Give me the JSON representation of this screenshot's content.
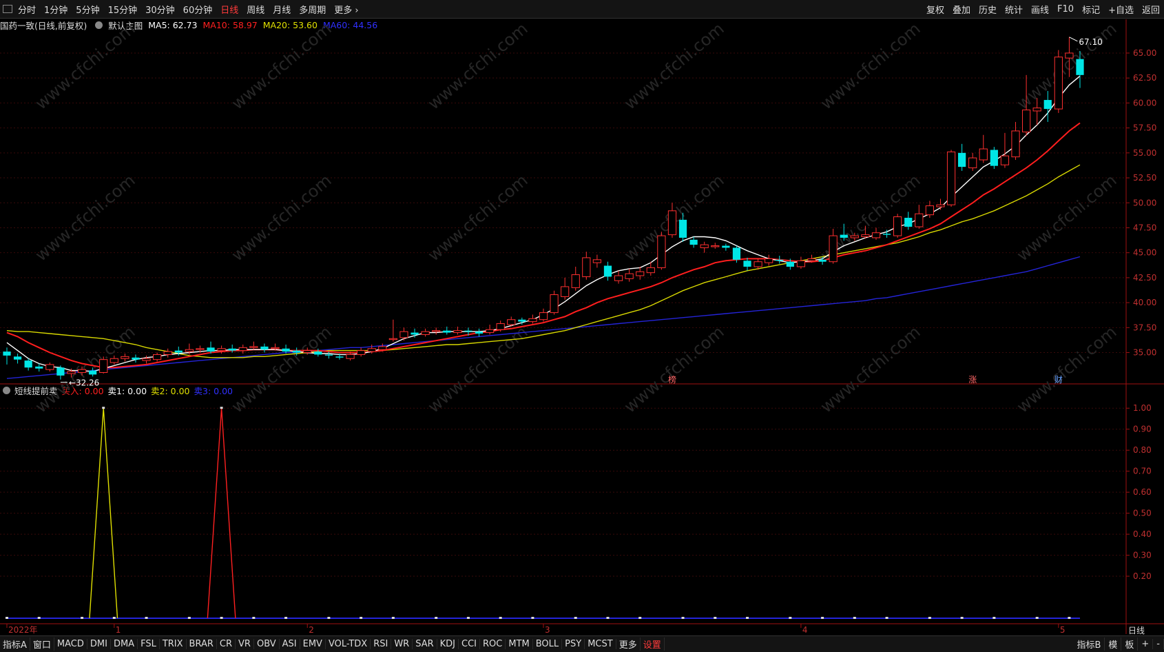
{
  "topbar": {
    "periods": [
      "分时",
      "1分钟",
      "5分钟",
      "15分钟",
      "30分钟",
      "60分钟",
      "日线",
      "周线",
      "月线",
      "多周期",
      "更多 ›"
    ],
    "active_period": "日线",
    "tools": [
      "复权",
      "叠加",
      "历史",
      "统计",
      "画线",
      "F10",
      "标记",
      "+自选",
      "返回"
    ]
  },
  "main_legend": {
    "stock": "国药一致(日线,前复权)",
    "template": "默认主图",
    "ma": [
      {
        "label": "MA5: 62.73",
        "color": "#ffffff"
      },
      {
        "label": "MA10: 58.97",
        "color": "#ff2020"
      },
      {
        "label": "MA20: 53.60",
        "color": "#e0e000"
      },
      {
        "label": "MA60: 44.56",
        "color": "#3030ff"
      }
    ]
  },
  "sub_legend": {
    "name": "短线提前卖",
    "items": [
      {
        "label": "买入: 0.00",
        "color": "#ff2020"
      },
      {
        "label": "卖1: 0.00",
        "color": "#ffffff"
      },
      {
        "label": "卖2: 0.00",
        "color": "#e0e000"
      },
      {
        "label": "卖3: 0.00",
        "color": "#3030ff"
      }
    ]
  },
  "chart_data": [
    {
      "type": "candlestick",
      "title": "国药一致(日线,前复权)",
      "ylim": [
        32,
        67
      ],
      "y_ticks": [
        "65.00",
        "62.50",
        "60.00",
        "57.50",
        "55.00",
        "52.50",
        "50.00",
        "47.50",
        "45.00",
        "42.50",
        "40.00",
        "37.50",
        "35.00"
      ],
      "x_labels": [
        "2022年",
        "1",
        "2",
        "3",
        "4",
        "5"
      ],
      "annotations": {
        "high": "67.10",
        "low": "32.26",
        "markers": [
          "榜",
          "涨",
          "财"
        ]
      },
      "candles": [
        [
          35.1,
          34.7,
          35.5,
          33.8
        ],
        [
          34.6,
          34.3,
          34.9,
          33.9
        ],
        [
          34.2,
          33.5,
          34.4,
          33.2
        ],
        [
          33.6,
          33.4,
          33.9,
          33.1
        ],
        [
          33.3,
          33.8,
          34.0,
          33.1
        ],
        [
          33.5,
          32.7,
          33.7,
          32.3
        ],
        [
          32.9,
          33.1,
          33.4,
          32.5
        ],
        [
          33.0,
          33.3,
          33.6,
          32.7
        ],
        [
          33.2,
          32.8,
          33.5,
          32.6
        ],
        [
          33.0,
          34.3,
          34.6,
          32.9
        ],
        [
          34.0,
          34.4,
          34.7,
          33.8
        ],
        [
          34.4,
          34.6,
          34.9,
          34.1
        ],
        [
          34.5,
          34.3,
          34.8,
          34.0
        ],
        [
          34.2,
          34.4,
          34.7,
          33.9
        ],
        [
          34.3,
          34.8,
          35.0,
          34.1
        ],
        [
          34.8,
          35.1,
          35.4,
          34.5
        ],
        [
          35.2,
          35.0,
          35.6,
          34.7
        ],
        [
          35.1,
          35.3,
          35.9,
          34.8
        ],
        [
          35.3,
          35.4,
          35.7,
          35.0
        ],
        [
          35.5,
          35.1,
          36.1,
          34.9
        ],
        [
          35.2,
          35.4,
          35.7,
          34.9
        ],
        [
          35.4,
          35.2,
          35.8,
          35.0
        ],
        [
          35.2,
          35.5,
          35.8,
          34.9
        ],
        [
          35.5,
          35.6,
          36.1,
          35.3
        ],
        [
          35.6,
          35.3,
          35.9,
          35.0
        ],
        [
          35.4,
          35.5,
          35.9,
          35.2
        ],
        [
          35.4,
          35.1,
          35.8,
          34.9
        ],
        [
          35.2,
          35.0,
          35.5,
          34.7
        ],
        [
          35.0,
          35.2,
          35.5,
          34.8
        ],
        [
          35.1,
          34.8,
          35.4,
          34.6
        ],
        [
          34.8,
          34.7,
          35.1,
          34.4
        ],
        [
          34.6,
          34.5,
          34.9,
          34.3
        ],
        [
          34.4,
          34.8,
          35.1,
          34.2
        ],
        [
          34.8,
          35.2,
          35.5,
          34.6
        ],
        [
          35.1,
          35.4,
          35.8,
          34.9
        ],
        [
          35.3,
          35.6,
          35.9,
          35.1
        ],
        [
          36.3,
          36.4,
          38.3,
          36.1
        ],
        [
          36.5,
          37.1,
          37.5,
          36.2
        ],
        [
          37.0,
          36.8,
          37.4,
          36.5
        ],
        [
          36.8,
          37.1,
          37.4,
          36.6
        ],
        [
          37.1,
          37.2,
          37.5,
          36.8
        ],
        [
          37.2,
          37.0,
          37.6,
          36.8
        ],
        [
          37.0,
          37.2,
          37.6,
          36.8
        ],
        [
          37.2,
          37.1,
          37.5,
          36.7
        ],
        [
          37.1,
          36.9,
          37.4,
          36.6
        ],
        [
          37.0,
          37.3,
          37.8,
          36.8
        ],
        [
          37.3,
          37.9,
          38.2,
          37.1
        ],
        [
          37.8,
          38.3,
          38.6,
          37.6
        ],
        [
          38.3,
          38.1,
          38.5,
          37.8
        ],
        [
          38.1,
          38.4,
          38.8,
          37.9
        ],
        [
          38.3,
          39.0,
          39.4,
          38.1
        ],
        [
          39.0,
          40.8,
          41.2,
          38.8
        ],
        [
          40.6,
          41.6,
          42.5,
          40.3
        ],
        [
          41.5,
          42.8,
          43.6,
          41.2
        ],
        [
          42.6,
          44.5,
          45.1,
          42.3
        ],
        [
          44.0,
          44.3,
          44.8,
          43.5
        ],
        [
          43.7,
          42.6,
          44.1,
          42.2
        ],
        [
          42.2,
          42.7,
          43.2,
          41.9
        ],
        [
          42.4,
          42.9,
          43.4,
          42.1
        ],
        [
          42.7,
          43.1,
          43.6,
          42.3
        ],
        [
          43.0,
          43.5,
          44.1,
          42.7
        ],
        [
          43.5,
          46.7,
          47.1,
          43.3
        ],
        [
          46.8,
          49.2,
          50.0,
          46.5
        ],
        [
          48.3,
          46.5,
          49.0,
          46.1
        ],
        [
          46.3,
          45.8,
          46.6,
          45.5
        ],
        [
          45.5,
          45.8,
          46.1,
          45.0
        ],
        [
          45.6,
          45.7,
          46.0,
          45.4
        ],
        [
          45.7,
          45.5,
          45.9,
          45.2
        ],
        [
          45.5,
          44.3,
          45.7,
          44.0
        ],
        [
          44.2,
          43.6,
          44.5,
          43.2
        ],
        [
          43.6,
          44.1,
          44.4,
          43.3
        ],
        [
          44.0,
          44.4,
          44.8,
          43.7
        ],
        [
          44.3,
          44.2,
          44.7,
          43.9
        ],
        [
          44.1,
          43.6,
          44.4,
          43.3
        ],
        [
          43.6,
          44.2,
          44.6,
          43.4
        ],
        [
          44.2,
          44.4,
          44.8,
          44.0
        ],
        [
          44.3,
          44.1,
          44.6,
          43.8
        ],
        [
          44.1,
          46.7,
          47.4,
          43.9
        ],
        [
          46.8,
          46.5,
          47.9,
          46.2
        ],
        [
          46.5,
          46.7,
          47.0,
          46.2
        ],
        [
          46.6,
          46.8,
          47.7,
          46.4
        ],
        [
          46.5,
          47.0,
          47.5,
          46.3
        ],
        [
          46.9,
          46.8,
          47.3,
          46.5
        ],
        [
          46.7,
          48.6,
          48.9,
          46.5
        ],
        [
          48.5,
          47.6,
          49.1,
          47.3
        ],
        [
          47.6,
          48.9,
          49.8,
          47.4
        ],
        [
          48.8,
          49.7,
          50.2,
          48.5
        ],
        [
          49.6,
          49.8,
          50.4,
          49.3
        ],
        [
          49.8,
          55.1,
          55.3,
          49.6
        ],
        [
          55.0,
          53.6,
          55.9,
          53.2
        ],
        [
          53.5,
          54.5,
          55.0,
          53.2
        ],
        [
          54.3,
          55.4,
          56.8,
          54.0
        ],
        [
          55.3,
          53.7,
          55.6,
          53.4
        ],
        [
          53.8,
          54.7,
          57.0,
          53.5
        ],
        [
          54.6,
          57.2,
          58.1,
          54.3
        ],
        [
          57.1,
          59.3,
          62.8,
          56.7
        ],
        [
          59.2,
          59.5,
          60.5,
          57.8
        ],
        [
          60.3,
          59.4,
          61.2,
          58.1
        ],
        [
          59.4,
          64.6,
          65.3,
          59.0
        ],
        [
          64.5,
          65.0,
          66.6,
          62.6
        ],
        [
          64.4,
          62.8,
          65.2,
          61.5
        ]
      ],
      "ma5": [
        36.0,
        35.2,
        34.4,
        33.9,
        33.6,
        33.5,
        33.2,
        33.2,
        33.1,
        33.4,
        33.7,
        34.0,
        34.3,
        34.5,
        34.6,
        34.8,
        34.9,
        35.0,
        35.1,
        35.2,
        35.2,
        35.3,
        35.3,
        35.3,
        35.3,
        35.3,
        35.2,
        35.1,
        35.0,
        34.9,
        34.9,
        34.8,
        34.8,
        34.9,
        35.1,
        35.4,
        35.9,
        36.4,
        36.7,
        37.0,
        37.0,
        37.1,
        37.1,
        37.1,
        37.1,
        37.2,
        37.4,
        37.7,
        38.0,
        38.3,
        38.8,
        39.4,
        40.1,
        40.9,
        41.7,
        42.3,
        42.8,
        43.2,
        43.4,
        43.5,
        44.0,
        44.8,
        45.6,
        46.2,
        46.6,
        46.6,
        46.5,
        46.2,
        45.7,
        45.2,
        44.8,
        44.4,
        44.2,
        44.0,
        44.1,
        44.2,
        44.4,
        45.1,
        45.7,
        46.1,
        46.5,
        46.8,
        47.1,
        47.6,
        47.9,
        48.4,
        48.9,
        49.5,
        50.6,
        51.6,
        52.6,
        53.6,
        54.2,
        54.9,
        55.7,
        56.8,
        57.8,
        59.0,
        60.5,
        61.8,
        62.7
      ],
      "ma10": [
        37.0,
        36.6,
        36.0,
        35.5,
        35.0,
        34.6,
        34.2,
        33.9,
        33.7,
        33.5,
        33.5,
        33.6,
        33.7,
        33.8,
        34.0,
        34.2,
        34.4,
        34.6,
        34.8,
        35.0,
        35.1,
        35.2,
        35.2,
        35.3,
        35.3,
        35.3,
        35.2,
        35.2,
        35.2,
        35.2,
        35.1,
        35.0,
        35.0,
        35.0,
        35.1,
        35.2,
        35.4,
        35.6,
        35.8,
        36.0,
        36.2,
        36.4,
        36.6,
        36.8,
        37.0,
        37.1,
        37.3,
        37.4,
        37.6,
        37.8,
        38.0,
        38.3,
        38.6,
        39.1,
        39.5,
        40.0,
        40.4,
        40.7,
        41.0,
        41.3,
        41.6,
        42.0,
        42.5,
        42.9,
        43.3,
        43.6,
        44.0,
        44.2,
        44.3,
        44.4,
        44.4,
        44.4,
        44.3,
        44.2,
        44.1,
        44.1,
        44.2,
        44.5,
        44.8,
        45.0,
        45.2,
        45.5,
        45.8,
        46.2,
        46.6,
        47.0,
        47.4,
        47.9,
        48.6,
        49.3,
        50.0,
        50.8,
        51.4,
        52.1,
        52.8,
        53.5,
        54.3,
        55.2,
        56.2,
        57.2,
        58.0
      ],
      "ma20": [
        37.2,
        37.1,
        37.1,
        37.0,
        36.9,
        36.8,
        36.7,
        36.6,
        36.5,
        36.4,
        36.2,
        36.0,
        35.8,
        35.5,
        35.3,
        35.1,
        34.9,
        34.7,
        34.6,
        34.5,
        34.5,
        34.5,
        34.5,
        34.6,
        34.6,
        34.7,
        34.8,
        34.9,
        35.0,
        35.1,
        35.2,
        35.2,
        35.2,
        35.2,
        35.2,
        35.2,
        35.3,
        35.4,
        35.5,
        35.6,
        35.7,
        35.8,
        35.8,
        35.9,
        36.0,
        36.1,
        36.2,
        36.3,
        36.4,
        36.6,
        36.8,
        37.0,
        37.2,
        37.5,
        37.8,
        38.1,
        38.4,
        38.7,
        39.0,
        39.3,
        39.7,
        40.2,
        40.7,
        41.2,
        41.6,
        42.0,
        42.3,
        42.6,
        42.9,
        43.2,
        43.4,
        43.6,
        43.8,
        44.0,
        44.2,
        44.4,
        44.6,
        44.8,
        45.0,
        45.2,
        45.4,
        45.6,
        45.8,
        46.0,
        46.3,
        46.6,
        47.0,
        47.3,
        47.7,
        48.1,
        48.4,
        48.8,
        49.2,
        49.7,
        50.2,
        50.7,
        51.3,
        51.9,
        52.6,
        53.2,
        53.8
      ],
      "ma60": [
        32.4,
        32.5,
        32.6,
        32.7,
        32.8,
        32.9,
        33.0,
        33.1,
        33.2,
        33.3,
        33.4,
        33.5,
        33.6,
        33.7,
        33.8,
        33.9,
        34.0,
        34.1,
        34.2,
        34.3,
        34.4,
        34.5,
        34.6,
        34.7,
        34.8,
        34.9,
        35.0,
        35.0,
        35.1,
        35.2,
        35.3,
        35.4,
        35.5,
        35.5,
        35.6,
        35.7,
        35.8,
        35.9,
        36.0,
        36.1,
        36.2,
        36.3,
        36.4,
        36.5,
        36.6,
        36.7,
        36.8,
        36.9,
        37.0,
        37.1,
        37.2,
        37.3,
        37.4,
        37.5,
        37.6,
        37.7,
        37.8,
        37.9,
        38.0,
        38.1,
        38.2,
        38.3,
        38.4,
        38.5,
        38.6,
        38.7,
        38.8,
        38.9,
        39.0,
        39.1,
        39.2,
        39.3,
        39.4,
        39.5,
        39.6,
        39.7,
        39.8,
        39.9,
        40.0,
        40.1,
        40.2,
        40.4,
        40.5,
        40.7,
        40.9,
        41.1,
        41.3,
        41.5,
        41.7,
        41.9,
        42.1,
        42.3,
        42.5,
        42.7,
        42.9,
        43.1,
        43.4,
        43.7,
        44.0,
        44.3,
        44.6
      ]
    },
    {
      "type": "line",
      "title": "短线提前卖",
      "ylim": [
        0,
        1.05
      ],
      "y_ticks": [
        "1.00",
        "0.90",
        "0.80",
        "0.70",
        "0.60",
        "0.50",
        "0.40",
        "0.30",
        "0.20"
      ],
      "series": [
        {
          "name": "卖2",
          "color": "#e0e000",
          "spikes": [
            {
              "index": 9,
              "value": 1.0
            }
          ]
        },
        {
          "name": "买入",
          "color": "#ff2020",
          "spikes": [
            {
              "index": 20,
              "value": 1.0
            }
          ]
        }
      ],
      "n": 101
    }
  ],
  "bottombar": {
    "items": [
      "指标A",
      "窗口",
      "MACD",
      "DMI",
      "DMA",
      "FSL",
      "TRIX",
      "BRAR",
      "CR",
      "VR",
      "OBV",
      "ASI",
      "EMV",
      "VOL-TDX",
      "RSI",
      "WR",
      "SAR",
      "KDJ",
      "CCI",
      "ROC",
      "MTM",
      "BOLL",
      "PSY",
      "MCST",
      "更多",
      "设置"
    ],
    "right": [
      "指标B",
      "模",
      "板",
      "+",
      "-"
    ]
  },
  "period_tag": "日线",
  "watermark": "www.cfchi.com"
}
